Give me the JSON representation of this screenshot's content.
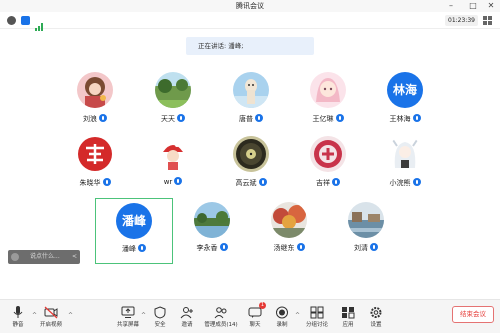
{
  "window": {
    "title": "腾讯会议"
  },
  "status": {
    "timer": "01:23:39"
  },
  "speaking": {
    "text": "正在讲话: 潘峰;"
  },
  "participants": [
    {
      "name": "刘浪",
      "avatar": "photo-girl"
    },
    {
      "name": "天天",
      "avatar": "photo-park"
    },
    {
      "name": "唐普",
      "avatar": "photo-alpaca"
    },
    {
      "name": "王亿琳",
      "avatar": "photo-anime-girl"
    },
    {
      "name": "王林海",
      "avatar": "text",
      "avatar_text": "林海"
    },
    {
      "name": "朱晓华",
      "avatar": "photo-red-calligraphy"
    },
    {
      "name": "wr",
      "avatar": "photo-red-hat-kid"
    },
    {
      "name": "高云斌",
      "avatar": "photo-record"
    },
    {
      "name": "吉祥",
      "avatar": "photo-paper-cut"
    },
    {
      "name": "小浣熊",
      "avatar": "photo-anime-white"
    },
    {
      "name": "潘峰",
      "avatar": "text",
      "avatar_text": "潘峰",
      "active": true
    },
    {
      "name": "李永香",
      "avatar": "photo-lake"
    },
    {
      "name": "汤继东",
      "avatar": "photo-autumn"
    },
    {
      "name": "刘清",
      "avatar": "photo-water"
    }
  ],
  "chat": {
    "placeholder": "说点什么...",
    "expand": "<"
  },
  "toolbar": {
    "mute": "静音",
    "video": "开启视频",
    "share": "共享屏幕",
    "security": "安全",
    "invite": "邀请",
    "members": "管理成员(14)",
    "chat": "聊天",
    "chat_badge": "1",
    "record": "录制",
    "breakout": "分组讨论",
    "apps": "应用",
    "settings": "设置",
    "end": "结束会议"
  },
  "colors": {
    "accent": "#1a73e8",
    "active_border": "#4cc37a",
    "end": "#e53935"
  }
}
